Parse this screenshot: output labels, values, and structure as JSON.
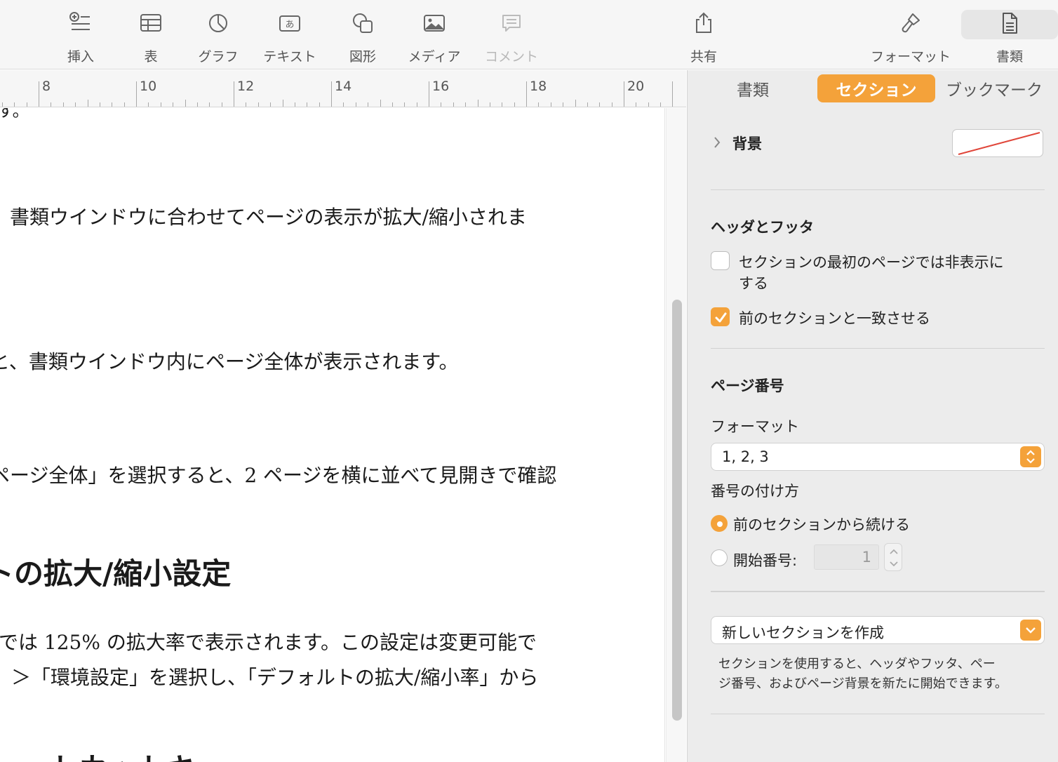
{
  "toolbar": {
    "insert": "挿入",
    "table": "表",
    "chart": "グラフ",
    "text": "テキスト",
    "shape": "図形",
    "media": "メディア",
    "comment": "コメント",
    "share": "共有",
    "format": "フォーマット",
    "document": "書類"
  },
  "ruler": {
    "numbers": [
      "8",
      "10",
      "12",
      "14",
      "16",
      "18",
      "20"
    ]
  },
  "document": {
    "fragment_top": "す。",
    "line1": "書類ウインドウに合わせてページの表示が拡大/縮小されま",
    "line2": "と、書類ウインドウ内にページ全体が表示されます。",
    "line3": "ページ全体」を選択すると、2 ページを横に並べて見開きで確認",
    "heading1": "トの拡大/縮小設定",
    "line4": "では 125% の拡大率で表示されます。この設定は変更可能で",
    "line5": "＞「環境設定」を選択し、「デフォルトの拡大/縮小率」から",
    "heading2_partial": "ョートカットキ"
  },
  "inspector": {
    "tabs": [
      "書類",
      "セクション",
      "ブックマーク"
    ],
    "active_tab": "セクション",
    "background_label": "背景",
    "header_footer_title": "ヘッダとフッタ",
    "hide_first_page_line1": "セクションの最初のページでは非表示に",
    "hide_first_page_line2": "する",
    "hide_first_page_checked": false,
    "match_previous": "前のセクションと一致させる",
    "match_previous_checked": true,
    "page_number_title": "ページ番号",
    "format_label": "フォーマット",
    "format_value": "1, 2, 3",
    "numbering_label": "番号の付け方",
    "continue_previous": "前のセクションから続ける",
    "start_at": "開始番号:",
    "start_at_value": "1",
    "new_section_button": "新しいセクションを作成",
    "help_line1": "セクションを使用すると、ヘッダやフッタ、ペー",
    "help_line2": "ジ番号、およびページ背景を新たに開始できます。"
  },
  "colors": {
    "accent": "#f4a23a",
    "toolbar_bg": "#f6f6f6",
    "inspector_bg": "#ececec"
  }
}
